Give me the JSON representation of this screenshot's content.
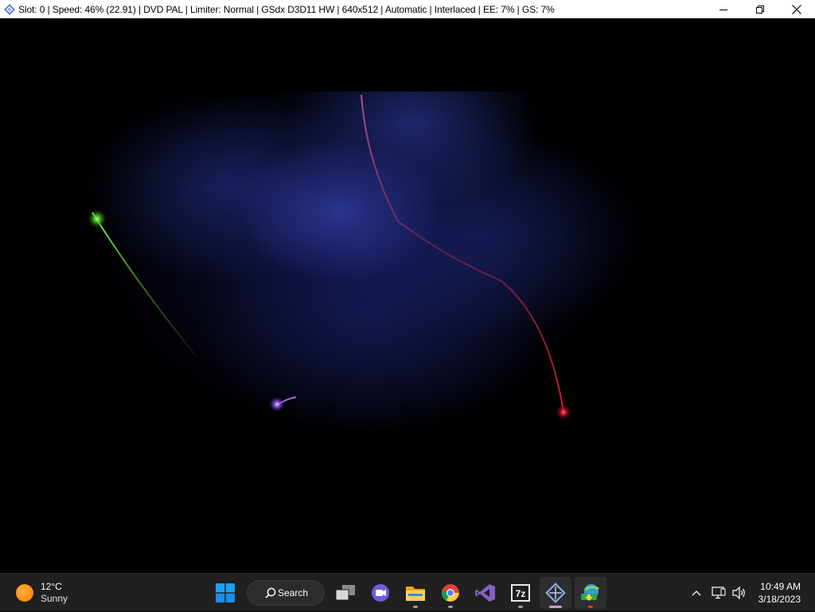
{
  "window": {
    "title": "Slot: 0 | Speed:  46% (22.91) | DVD PAL | Limiter: Normal | GSdx D3D11 HW | 640x512 | Automatic | Interlaced | EE:   7% | GS:   7%",
    "controls": [
      "minimize-icon",
      "restore-icon",
      "close-icon"
    ]
  },
  "game": {
    "description_colors": {
      "nebula": "#2b3aa0",
      "green_streak": "#6cff4a",
      "red_streak": "#ff2a3a",
      "pink_streak": "#c07aff"
    }
  },
  "taskbar": {
    "weather": {
      "temp": "12°C",
      "condition": "Sunny"
    },
    "search_label": "Search",
    "apps": [
      {
        "name": "start",
        "icon": "windows-logo-icon"
      },
      {
        "name": "task-view",
        "icon": "task-view-icon"
      },
      {
        "name": "teams",
        "icon": "teams-chat-icon"
      },
      {
        "name": "file-explorer",
        "icon": "folder-icon"
      },
      {
        "name": "chrome",
        "icon": "chrome-icon"
      },
      {
        "name": "visual-studio",
        "icon": "visual-studio-icon"
      },
      {
        "name": "7zip",
        "icon": "7zip-icon",
        "label": "7z"
      },
      {
        "name": "pcsx2",
        "icon": "pcsx2-icon"
      },
      {
        "name": "internet-download-manager",
        "icon": "idm-icon"
      }
    ],
    "tray": [
      "chevron-up-icon",
      "network-icon",
      "volume-icon"
    ],
    "clock": {
      "time": "10:49 AM",
      "date": "3/18/2023"
    }
  }
}
